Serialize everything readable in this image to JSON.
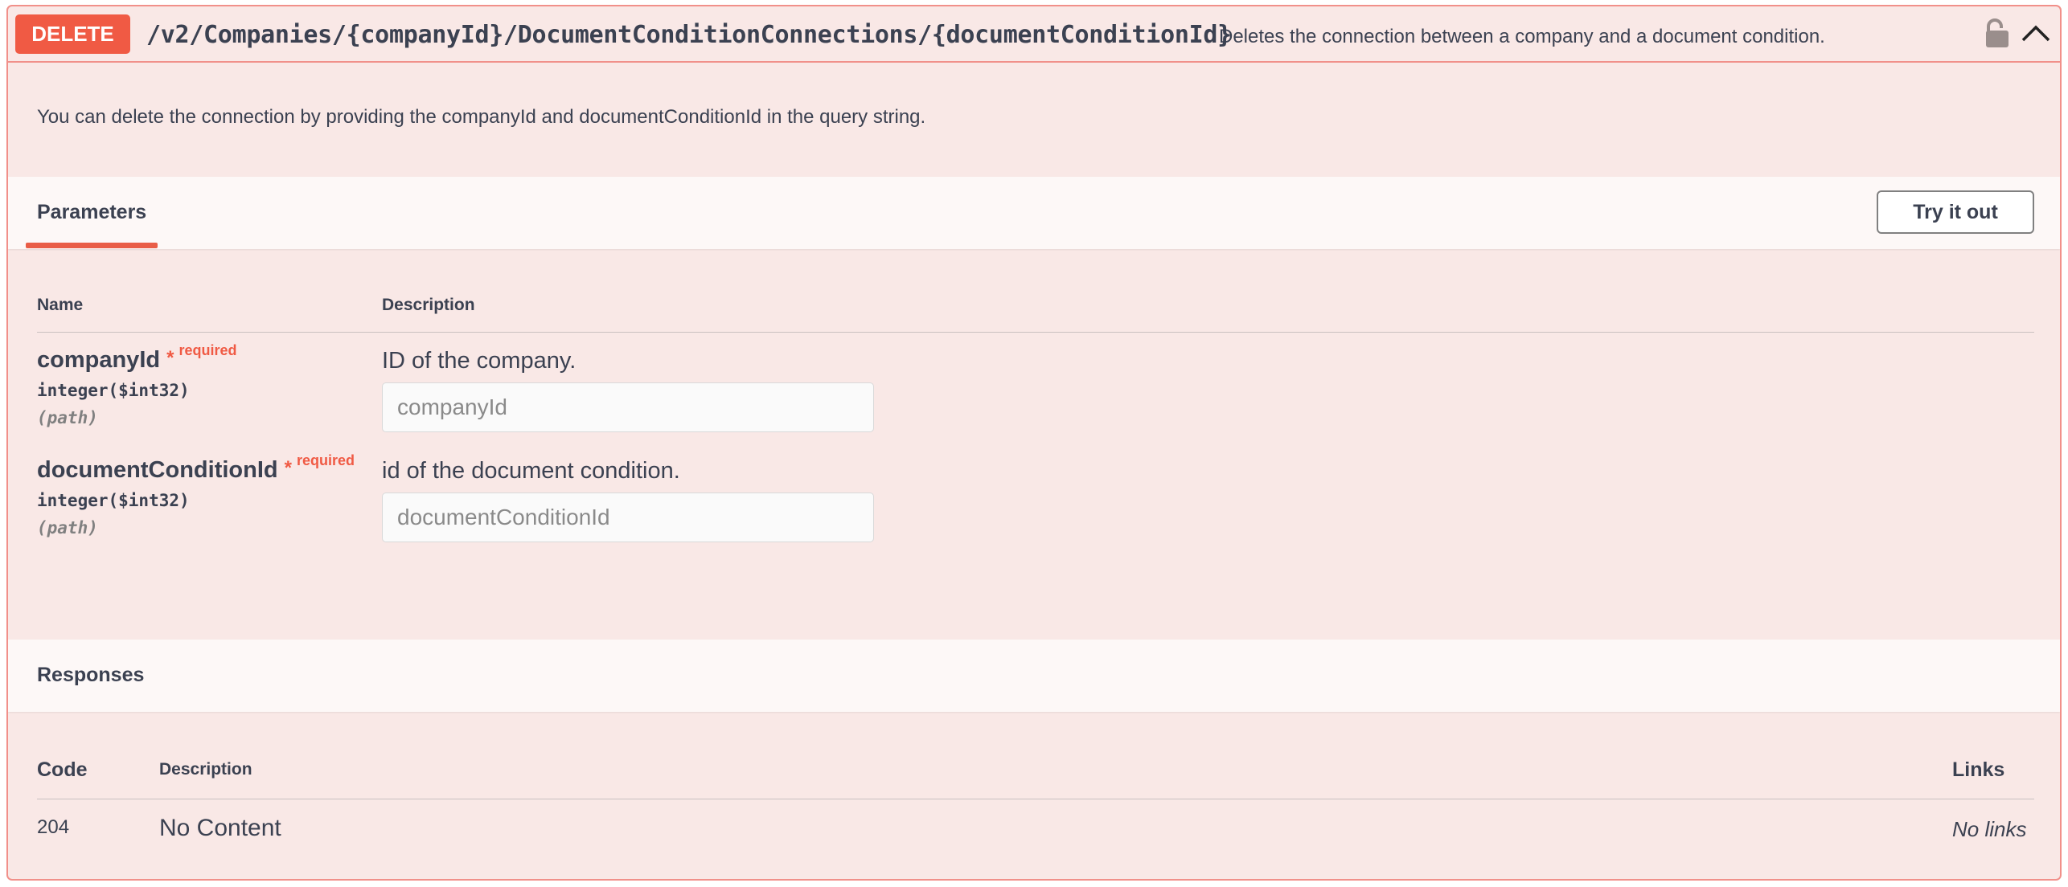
{
  "operation": {
    "method": "DELETE",
    "path": "/v2/Companies/{companyId}/DocumentConditionConnections/{documentConditionId}",
    "summary": "Deletes the connection between a company and a document condition.",
    "description": "You can delete the connection by providing the companyId and documentConditionId in the query string."
  },
  "parameters": {
    "title": "Parameters",
    "try_it_out_label": "Try it out",
    "col_name": "Name",
    "col_description": "Description",
    "items": [
      {
        "name": "companyId",
        "required_star": "*",
        "required_label": "required",
        "type": "integer($int32)",
        "in": "(path)",
        "description": "ID of the company.",
        "placeholder": "companyId"
      },
      {
        "name": "documentConditionId",
        "required_star": "*",
        "required_label": "required",
        "type": "integer($int32)",
        "in": "(path)",
        "description": "id of the document condition.",
        "placeholder": "documentConditionId"
      }
    ]
  },
  "responses": {
    "title": "Responses",
    "col_code": "Code",
    "col_description": "Description",
    "col_links": "Links",
    "items": [
      {
        "code": "204",
        "description": "No Content",
        "links": "No links"
      }
    ]
  },
  "icons": {
    "lock": "lock-icon",
    "collapse": "chevron-up-icon"
  },
  "colors": {
    "method": "#f05a44",
    "border": "#f1908a",
    "background": "#f9e8e6"
  }
}
